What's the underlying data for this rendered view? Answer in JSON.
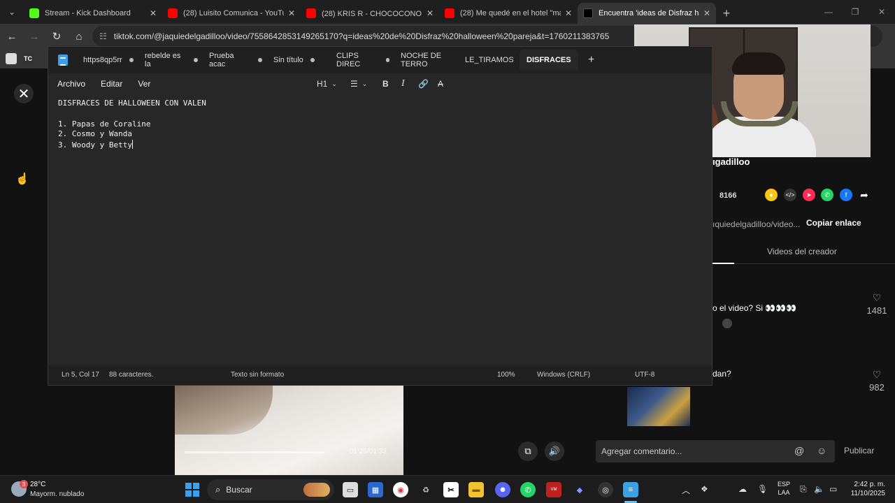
{
  "browser": {
    "tabs": [
      {
        "label": "Stream - Kick Dashboard",
        "favicon_color": "#53fc18",
        "active": false
      },
      {
        "label": "(28) Luisito Comunica - YouTub",
        "favicon_color": "#ff0000",
        "active": false
      },
      {
        "label": "(28) KRIS R - CHOCOCONO 🫃",
        "favicon_color": "#ff0000",
        "active": false
      },
      {
        "label": "(28) Me quedé en el hotel \"más",
        "favicon_color": "#ff0000",
        "active": false
      },
      {
        "label": "Encuentra 'ideas de Disfraz hall",
        "favicon_color": "#000000",
        "active": true
      }
    ],
    "url": "tiktok.com/@jaquiedelgadilloo/video/7558642853149265170?q=ideas%20de%20Disfraz%20halloween%20pareja&t=1760211383765",
    "bookmark_label": "TC"
  },
  "notepad": {
    "tabs": [
      {
        "label": "https8qp5rr",
        "active": false
      },
      {
        "label": "rebelde es la",
        "active": false
      },
      {
        "label": "Prueba acac",
        "active": false
      },
      {
        "label": "Sin título",
        "active": false
      },
      {
        "label": "CLIPS DIREC",
        "active": false
      },
      {
        "label": "NOCHE DE TERRO",
        "active": false
      },
      {
        "label": "LE_TIRAMOS",
        "active": false
      },
      {
        "label": "DISFRACES",
        "active": true
      }
    ],
    "menu": {
      "file": "Archivo",
      "edit": "Editar",
      "view": "Ver"
    },
    "format": {
      "heading": "H1",
      "bold": "B",
      "italic": "I"
    },
    "lines": [
      "DISFRACES DE HALLOWEEN CON VALEN",
      "",
      "1. Papas de Coraline",
      "2. Cosmo y Wanda",
      "3. Woody y Betty"
    ],
    "status": {
      "position": "Ln 5, Col 17",
      "chars": "88 caracteres.",
      "format": "Texto sin formato",
      "zoom": "100%",
      "line_ending": "Windows (CRLF)",
      "encoding": "UTF-8"
    }
  },
  "tiktok": {
    "handle": "ıgadilloo",
    "count": "8166",
    "link_preview": "ıquiedelgadilloo/video...",
    "copy_link": "Copiar enlace",
    "creator_videos": "Videos del creador",
    "comment1": "o el video? Si 👀👀👀",
    "comment1_likes": "1481",
    "comment2": "dan?",
    "comment2_likes": "982",
    "comment_placeholder": "Agregar comentario...",
    "publish": "Publicar",
    "video_time": "01:25/01:33"
  },
  "taskbar": {
    "temperature": "28°C",
    "weather": "Mayorm. nublado",
    "weather_badge": "3",
    "search": "Buscar",
    "lang_top": "ESP",
    "lang_bottom": "LAA",
    "time": "2:42 p. m.",
    "date": "11/10/2025"
  }
}
